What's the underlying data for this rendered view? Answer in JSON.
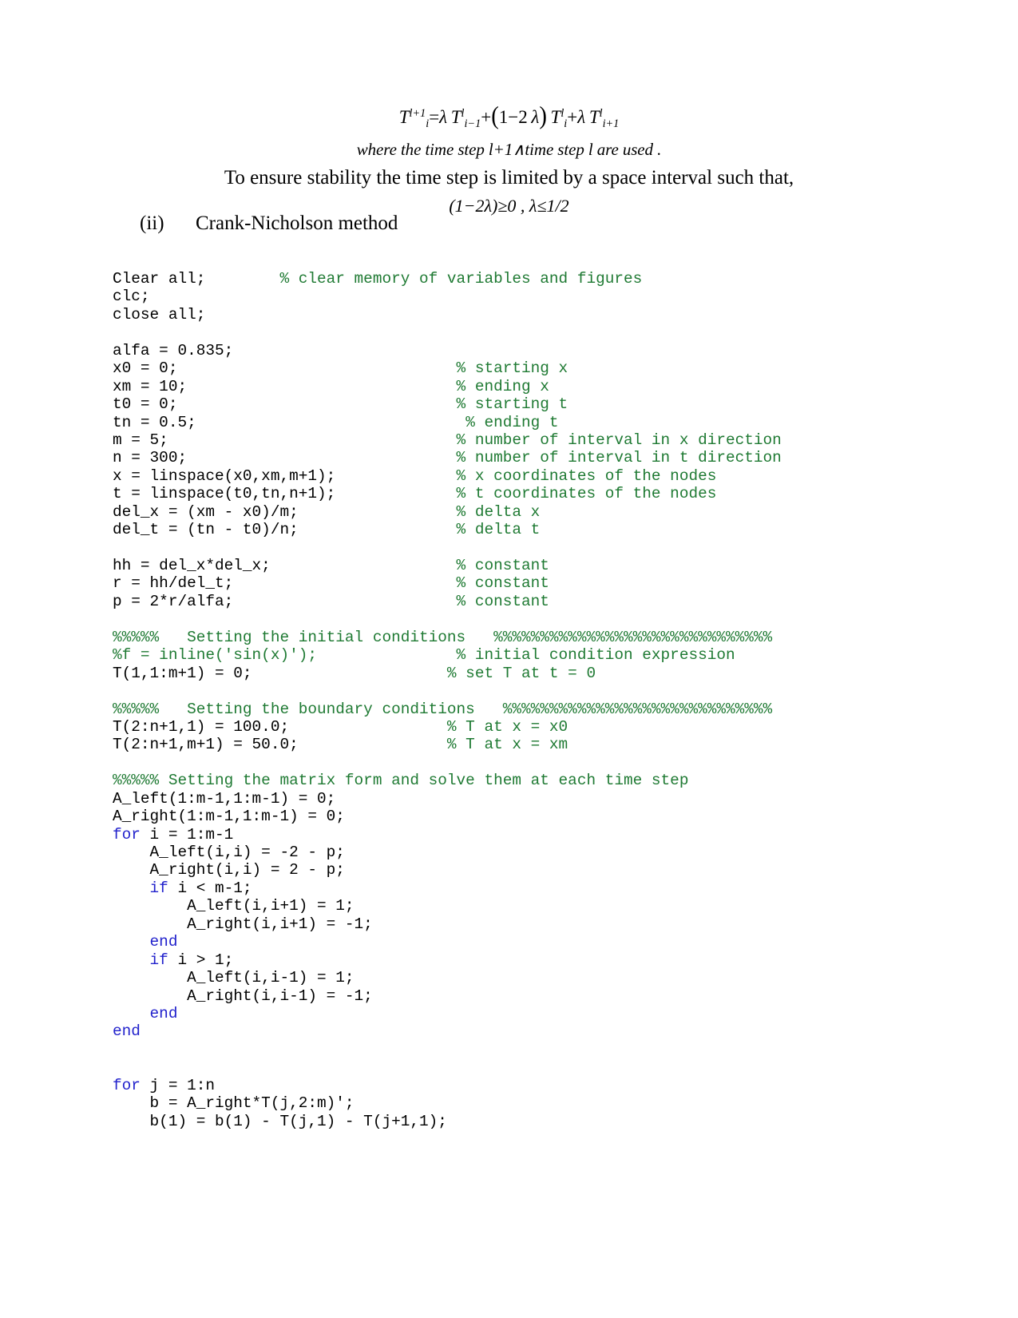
{
  "equation": {
    "main_html_parts": {
      "lhs": "T",
      "lhs_sup": "l+1",
      "lhs_sub": "i",
      "text_plain": "T_i^{l+1} = λ T_{i-1}^{l} + (1-2λ) T_i^{l} + λ T_{i+1}^{l}"
    },
    "where_line": "where the time step l+1∧time step l are used .",
    "stability_line": "To ensure stability the time step is limited by a space interval such that,",
    "condition_line": "(1−2λ)≥0 , λ≤1/2"
  },
  "heading": {
    "marker": "(ii)",
    "title": "Crank-Nicholson method"
  },
  "colors": {
    "comment": "#1f7a33",
    "keyword": "#2222cc",
    "code": "#000000"
  },
  "code": {
    "language": "matlab",
    "lines": [
      {
        "t": "code",
        "segments": [
          {
            "c": "plain",
            "s": "Clear all;        "
          },
          {
            "c": "cmt",
            "s": "% clear memory of variables and figures"
          }
        ]
      },
      {
        "t": "code",
        "segments": [
          {
            "c": "plain",
            "s": "clc;"
          }
        ]
      },
      {
        "t": "code",
        "segments": [
          {
            "c": "plain",
            "s": "close all;"
          }
        ]
      },
      {
        "t": "blank",
        "segments": []
      },
      {
        "t": "code",
        "segments": [
          {
            "c": "plain",
            "s": "alfa = 0.835;"
          }
        ]
      },
      {
        "t": "code",
        "segments": [
          {
            "c": "plain",
            "s": "x0 = 0;                              "
          },
          {
            "c": "cmt",
            "s": "% starting x"
          }
        ]
      },
      {
        "t": "code",
        "segments": [
          {
            "c": "plain",
            "s": "xm = 10;                             "
          },
          {
            "c": "cmt",
            "s": "% ending x"
          }
        ]
      },
      {
        "t": "code",
        "segments": [
          {
            "c": "plain",
            "s": "t0 = 0;                              "
          },
          {
            "c": "cmt",
            "s": "% starting t"
          }
        ]
      },
      {
        "t": "code",
        "segments": [
          {
            "c": "plain",
            "s": "tn = 0.5;                             "
          },
          {
            "c": "cmt",
            "s": "% ending t"
          }
        ]
      },
      {
        "t": "code",
        "segments": [
          {
            "c": "plain",
            "s": "m = 5;                               "
          },
          {
            "c": "cmt",
            "s": "% number of interval in x direction"
          }
        ]
      },
      {
        "t": "code",
        "segments": [
          {
            "c": "plain",
            "s": "n = 300;                             "
          },
          {
            "c": "cmt",
            "s": "% number of interval in t direction"
          }
        ]
      },
      {
        "t": "code",
        "segments": [
          {
            "c": "plain",
            "s": "x = linspace(x0,xm,m+1);             "
          },
          {
            "c": "cmt",
            "s": "% x coordinates of the nodes"
          }
        ]
      },
      {
        "t": "code",
        "segments": [
          {
            "c": "plain",
            "s": "t = linspace(t0,tn,n+1);             "
          },
          {
            "c": "cmt",
            "s": "% t coordinates of the nodes"
          }
        ]
      },
      {
        "t": "code",
        "segments": [
          {
            "c": "plain",
            "s": "del_x = (xm - x0)/m;                 "
          },
          {
            "c": "cmt",
            "s": "% delta x"
          }
        ]
      },
      {
        "t": "code",
        "segments": [
          {
            "c": "plain",
            "s": "del_t = (tn - t0)/n;                 "
          },
          {
            "c": "cmt",
            "s": "% delta t"
          }
        ]
      },
      {
        "t": "blank",
        "segments": []
      },
      {
        "t": "code",
        "segments": [
          {
            "c": "plain",
            "s": "hh = del_x*del_x;                    "
          },
          {
            "c": "cmt",
            "s": "% constant"
          }
        ]
      },
      {
        "t": "code",
        "segments": [
          {
            "c": "plain",
            "s": "r = hh/del_t;                        "
          },
          {
            "c": "cmt",
            "s": "% constant"
          }
        ]
      },
      {
        "t": "code",
        "segments": [
          {
            "c": "plain",
            "s": "p = 2*r/alfa;                        "
          },
          {
            "c": "cmt",
            "s": "% constant"
          }
        ]
      },
      {
        "t": "blank",
        "segments": []
      },
      {
        "t": "code",
        "segments": [
          {
            "c": "cmt",
            "s": "%%%%%   Setting the initial conditions   %%%%%%%%%%%%%%%%%%%%%%%%%%%%%%"
          }
        ]
      },
      {
        "t": "code",
        "segments": [
          {
            "c": "cmt",
            "s": "%f = inline('sin(x)');               % initial condition expression"
          }
        ]
      },
      {
        "t": "code",
        "segments": [
          {
            "c": "plain",
            "s": "T(1,1:m+1) = 0;                     "
          },
          {
            "c": "cmt",
            "s": "% set T at t = 0"
          }
        ]
      },
      {
        "t": "blank",
        "segments": []
      },
      {
        "t": "code",
        "segments": [
          {
            "c": "cmt",
            "s": "%%%%%   Setting the boundary conditions   %%%%%%%%%%%%%%%%%%%%%%%%%%%%%"
          }
        ]
      },
      {
        "t": "code",
        "segments": [
          {
            "c": "plain",
            "s": "T(2:n+1,1) = 100.0;                 "
          },
          {
            "c": "cmt",
            "s": "% T at x = x0"
          }
        ]
      },
      {
        "t": "code",
        "segments": [
          {
            "c": "plain",
            "s": "T(2:n+1,m+1) = 50.0;                "
          },
          {
            "c": "cmt",
            "s": "% T at x = xm"
          }
        ]
      },
      {
        "t": "blank",
        "segments": []
      },
      {
        "t": "code",
        "segments": [
          {
            "c": "cmt",
            "s": "%%%%% Setting the matrix form and solve them at each time step"
          }
        ]
      },
      {
        "t": "code",
        "segments": [
          {
            "c": "plain",
            "s": "A_left(1:m-1,1:m-1) = 0;"
          }
        ]
      },
      {
        "t": "code",
        "segments": [
          {
            "c": "plain",
            "s": "A_right(1:m-1,1:m-1) = 0;"
          }
        ]
      },
      {
        "t": "code",
        "segments": [
          {
            "c": "kw",
            "s": "for"
          },
          {
            "c": "plain",
            "s": " i = 1:m-1"
          }
        ]
      },
      {
        "t": "code",
        "segments": [
          {
            "c": "plain",
            "s": "    A_left(i,i) = -2 - p;"
          }
        ]
      },
      {
        "t": "code",
        "segments": [
          {
            "c": "plain",
            "s": "    A_right(i,i) = 2 - p;"
          }
        ]
      },
      {
        "t": "code",
        "segments": [
          {
            "c": "plain",
            "s": "    "
          },
          {
            "c": "kw",
            "s": "if"
          },
          {
            "c": "plain",
            "s": " i < m-1;"
          }
        ]
      },
      {
        "t": "code",
        "segments": [
          {
            "c": "plain",
            "s": "        A_left(i,i+1) = 1;"
          }
        ]
      },
      {
        "t": "code",
        "segments": [
          {
            "c": "plain",
            "s": "        A_right(i,i+1) = -1;"
          }
        ]
      },
      {
        "t": "code",
        "segments": [
          {
            "c": "plain",
            "s": "    "
          },
          {
            "c": "kw",
            "s": "end"
          }
        ]
      },
      {
        "t": "code",
        "segments": [
          {
            "c": "plain",
            "s": "    "
          },
          {
            "c": "kw",
            "s": "if"
          },
          {
            "c": "plain",
            "s": " i > 1;"
          }
        ]
      },
      {
        "t": "code",
        "segments": [
          {
            "c": "plain",
            "s": "        A_left(i,i-1) = 1;"
          }
        ]
      },
      {
        "t": "code",
        "segments": [
          {
            "c": "plain",
            "s": "        A_right(i,i-1) = -1;"
          }
        ]
      },
      {
        "t": "code",
        "segments": [
          {
            "c": "plain",
            "s": "    "
          },
          {
            "c": "kw",
            "s": "end"
          }
        ]
      },
      {
        "t": "code",
        "segments": [
          {
            "c": "kw",
            "s": "end"
          }
        ]
      },
      {
        "t": "blank",
        "segments": []
      },
      {
        "t": "blank",
        "segments": []
      },
      {
        "t": "code",
        "segments": [
          {
            "c": "kw",
            "s": "for"
          },
          {
            "c": "plain",
            "s": " j = 1:n"
          }
        ]
      },
      {
        "t": "code",
        "segments": [
          {
            "c": "plain",
            "s": "    b = A_right*T(j,2:m)';"
          }
        ]
      },
      {
        "t": "code",
        "segments": [
          {
            "c": "plain",
            "s": "    b(1) = b(1) - T(j,1) - T(j+1,1);"
          }
        ]
      }
    ]
  }
}
